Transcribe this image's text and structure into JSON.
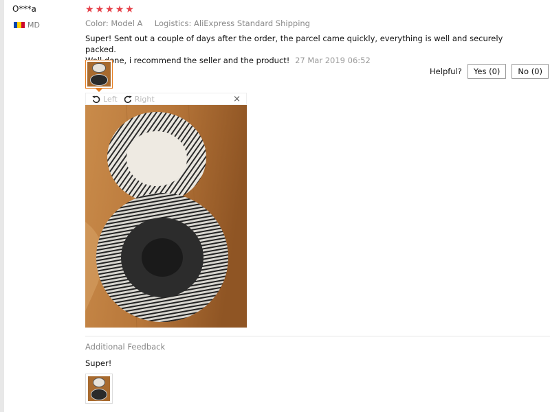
{
  "reviewer": {
    "name": "O***a",
    "country_code": "MD",
    "flag_colors": [
      "#0046ae",
      "#ffd200",
      "#cc092f"
    ]
  },
  "rating": {
    "stars": 5,
    "max": 5,
    "star_color": "#e6424a"
  },
  "order_info": {
    "color_label": "Color:",
    "color_value": "Model A",
    "logistics_label": "Logistics:",
    "logistics_value": "AliExpress Standard Shipping"
  },
  "review": {
    "line1": "Super! Sent out a couple of days after the order, the parcel came quickly, everything is well and securely packed.",
    "line2": "Well done, i recommend the seller and the product!",
    "date": "27 Mar 2019 06:52"
  },
  "helpful": {
    "label": "Helpful?",
    "yes_label": "Yes (0)",
    "no_label": "No (0)"
  },
  "viewer": {
    "rotate_left_label": "Left",
    "rotate_right_label": "Right",
    "close_glyph": "×"
  },
  "additional_feedback": {
    "label": "Additional Feedback",
    "text": "Super!"
  },
  "colors": {
    "accent_orange": "#e67e22",
    "muted_text": "#888888",
    "wood": "#b8773a"
  },
  "icons": {
    "rotate_left": "rotate-left-icon",
    "rotate_right": "rotate-right-icon",
    "close": "close-icon",
    "star": "star-icon",
    "flag": "flag-icon"
  }
}
